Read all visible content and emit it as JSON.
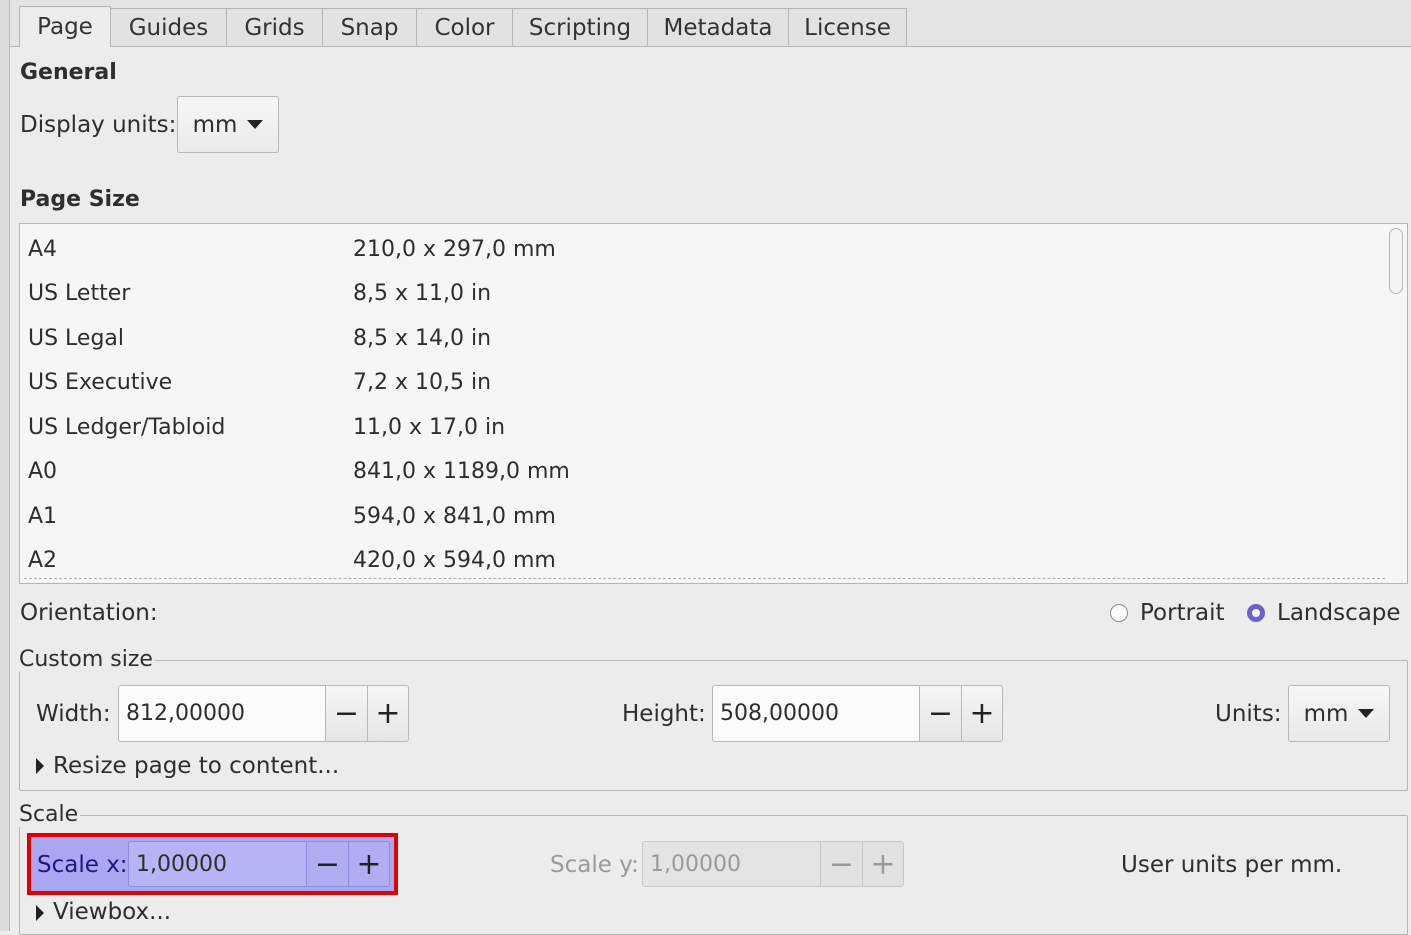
{
  "tabs": [
    "Page",
    "Guides",
    "Grids",
    "Snap",
    "Color",
    "Scripting",
    "Metadata",
    "License"
  ],
  "general": {
    "heading": "General",
    "display_units_label": "Display units:",
    "display_units_value": "mm"
  },
  "page_size": {
    "heading": "Page Size",
    "rows": [
      {
        "name": "A4",
        "size": "210,0 x 297,0 mm"
      },
      {
        "name": "US Letter",
        "size": "8,5 x 11,0 in"
      },
      {
        "name": "US Legal",
        "size": "8,5 x 14,0 in"
      },
      {
        "name": "US Executive",
        "size": "7,2 x 10,5 in"
      },
      {
        "name": "US Ledger/Tabloid",
        "size": "11,0 x 17,0 in"
      },
      {
        "name": "A0",
        "size": "841,0 x 1189,0 mm"
      },
      {
        "name": "A1",
        "size": "594,0 x 841,0 mm"
      },
      {
        "name": "A2",
        "size": "420,0 x 594,0 mm"
      }
    ]
  },
  "orientation": {
    "label": "Orientation:",
    "portrait": "Portrait",
    "landscape": "Landscape",
    "selected": "landscape"
  },
  "custom_size": {
    "legend": "Custom size",
    "width_label": "Width:",
    "width_value": "812,00000",
    "height_label": "Height:",
    "height_value": "508,00000",
    "units_label": "Units:",
    "units_value": "mm",
    "resize_label": "Resize page to content..."
  },
  "scale": {
    "legend": "Scale",
    "scale_x_label": "Scale x:",
    "scale_x_value": "1,00000",
    "scale_y_label": "Scale y:",
    "scale_y_value": "1,00000",
    "user_units": "User units per mm.",
    "viewbox_label": "Viewbox..."
  },
  "colors": {
    "highlight_border": "#e00000",
    "highlight_fill": "#a9a6f2",
    "radio_accent": "#6b63c8"
  }
}
